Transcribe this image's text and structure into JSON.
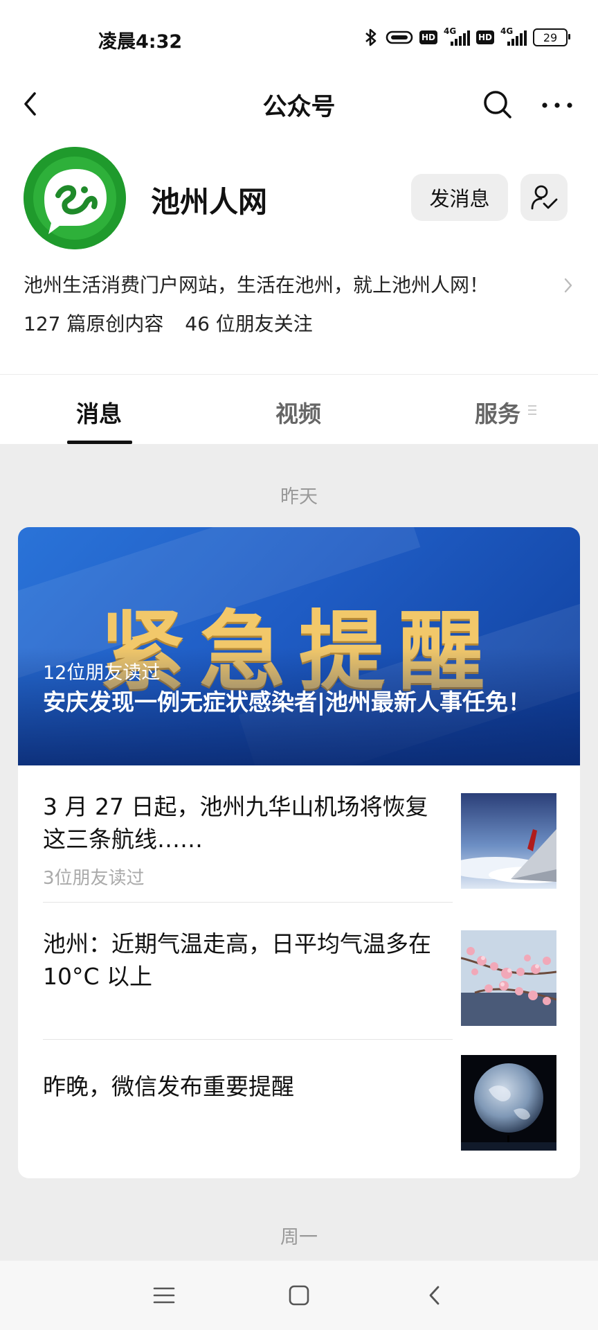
{
  "status_bar": {
    "time": "凌晨4:32",
    "hd1": "HD",
    "net1": "4G",
    "hd2": "HD",
    "net2": "4G",
    "battery": "29"
  },
  "nav": {
    "title": "公众号",
    "icons": [
      "back-arrow-icon",
      "search-icon",
      "more-icon"
    ]
  },
  "profile": {
    "name": "池州人网",
    "send_message_label": "发消息",
    "description": "池州生活消费门户网站，生活在池州，就上池州人网！",
    "original_count": "127 篇原创内容",
    "friends_following": "46 位朋友关注"
  },
  "tabs": [
    {
      "label": "消息",
      "active": true
    },
    {
      "label": "视频",
      "active": false
    },
    {
      "label": "服务",
      "active": false
    }
  ],
  "feed": {
    "date1": "昨天",
    "hero": {
      "banner_text": "紧急提醒",
      "readers": "12位朋友读过",
      "title": "安庆发现一例无症状感染者|池州最新人事任免！"
    },
    "articles": [
      {
        "title": "3 月 27 日起，池州九华山机场将恢复这三条航线……",
        "readers": "3位朋友读过",
        "thumb": "airplane-wing-image"
      },
      {
        "title": "池州：近期气温走高，日平均气温多在 10°C 以上",
        "readers": "",
        "thumb": "blossom-image"
      },
      {
        "title": "昨晚，微信发布重要提醒",
        "readers": "",
        "thumb": "earth-image"
      }
    ],
    "date2": "周一"
  },
  "colors": {
    "accent_green": "#1f9a2c",
    "banner_blue": "#1f5cc4",
    "banner_gold": "#f2c86a",
    "feed_bg": "#ededed"
  }
}
